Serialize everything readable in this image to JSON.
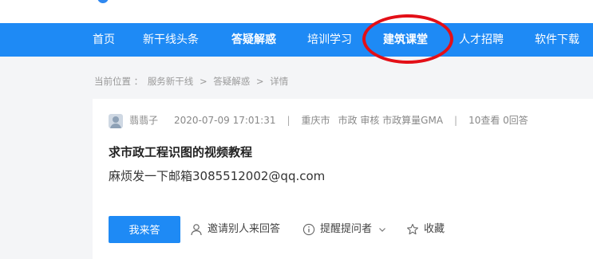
{
  "nav": {
    "items": [
      {
        "label": "首页"
      },
      {
        "label": "新干线头条"
      },
      {
        "label": "答疑解惑"
      },
      {
        "label": "培训学习"
      },
      {
        "label": "建筑课堂"
      },
      {
        "label": "人才招聘"
      },
      {
        "label": "软件下载"
      }
    ],
    "active_label": "答疑解惑",
    "highlighted_label": "建筑课堂"
  },
  "breadcrumb": {
    "prefix": "当前位置 ：",
    "items": [
      "服务新干线",
      "答疑解惑",
      "详情"
    ],
    "separator": ">"
  },
  "question": {
    "author": "翡翡子",
    "datetime": "2020-07-09 17:01:31",
    "location": "重庆市",
    "tags": "市政 审核 市政算量GMA",
    "stats": "10查看 0回答",
    "title": "求市政工程识图的视频教程",
    "body": "麻烦发一下邮箱3085512002@qq.com"
  },
  "actions": {
    "answer_button": "我来答",
    "invite": "邀请别人来回答",
    "remind": "提醒提问者",
    "favorite": "收藏"
  },
  "colors": {
    "nav_bg": "#1e8af5",
    "highlight_ring": "#e30f17",
    "button_bg": "#1e8af5"
  }
}
